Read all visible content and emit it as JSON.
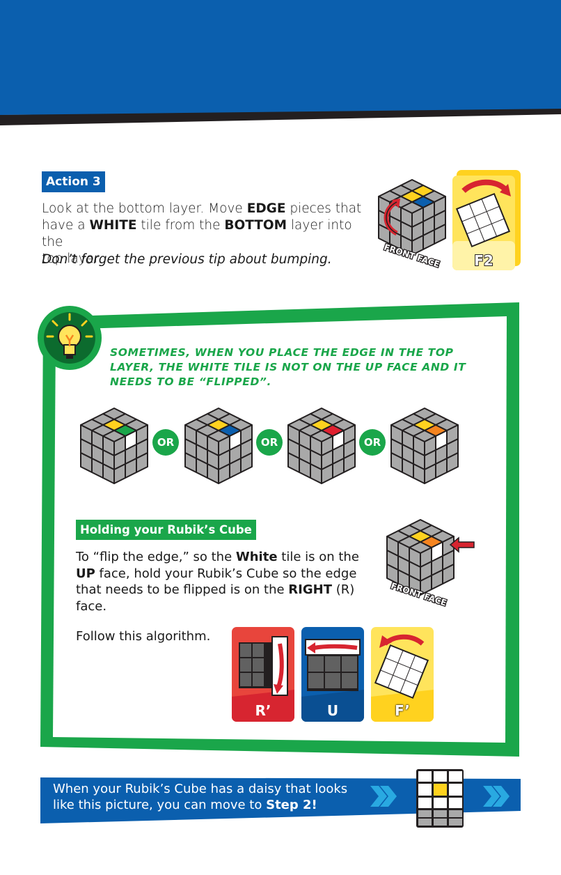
{
  "action": {
    "badge": "Action 3",
    "line1_a": "Look at the bottom layer. Move ",
    "line1_b": "EDGE",
    "line1_c": " pieces that",
    "line2_a": "have a ",
    "line2_b": "WHITE",
    "line2_c": " tile from the ",
    "line2_d": "BOTTOM",
    "line2_e": " layer into the",
    "line3": "top layer.",
    "tip": "Don’t forget the previous tip about bumping.",
    "front_face_label": "FRONT FACE",
    "move_card_label": "F2"
  },
  "tip": {
    "heading": "Sometimes, when you place the edge in the top layer, the white tile is not on the up face and it needs to be “flipped”.",
    "or_label": "OR",
    "cube_edge_colors": [
      "#1aa64a",
      "#0b5fae",
      "#e02030",
      "#f5841f"
    ]
  },
  "holding": {
    "badge": "Holding your Rubik’s Cube",
    "t1": "To “flip the edge,” so the ",
    "t2": "White",
    "t3": " tile is on the ",
    "t4": "UP",
    "t5": " face, hold your Rubik’s Cube so the edge that needs to be flipped is on the ",
    "t6": "RIGHT",
    "t7": " (R) face.",
    "front_face_label": "FRONT FACE"
  },
  "algorithm": {
    "intro": "Follow this algorithm.",
    "moves": [
      {
        "label": "R’",
        "color": "#e8453c"
      },
      {
        "label": "U",
        "color": "#0b5fae"
      },
      {
        "label": "F’",
        "color": "#ffe45c"
      }
    ]
  },
  "footer": {
    "t1": "When your Rubik’s Cube has a daisy that looks like this picture, you can move to ",
    "t2": "Step 2!"
  },
  "colors": {
    "blue": "#0b5fae",
    "green": "#1aa64a",
    "yellow": "#ffd21f",
    "red": "#e02030",
    "orange": "#f5841f",
    "grey": "#a9a9a9"
  },
  "icons": [
    "lightbulb-icon",
    "double-chevron-icon",
    "rotate-arrow-icon"
  ]
}
